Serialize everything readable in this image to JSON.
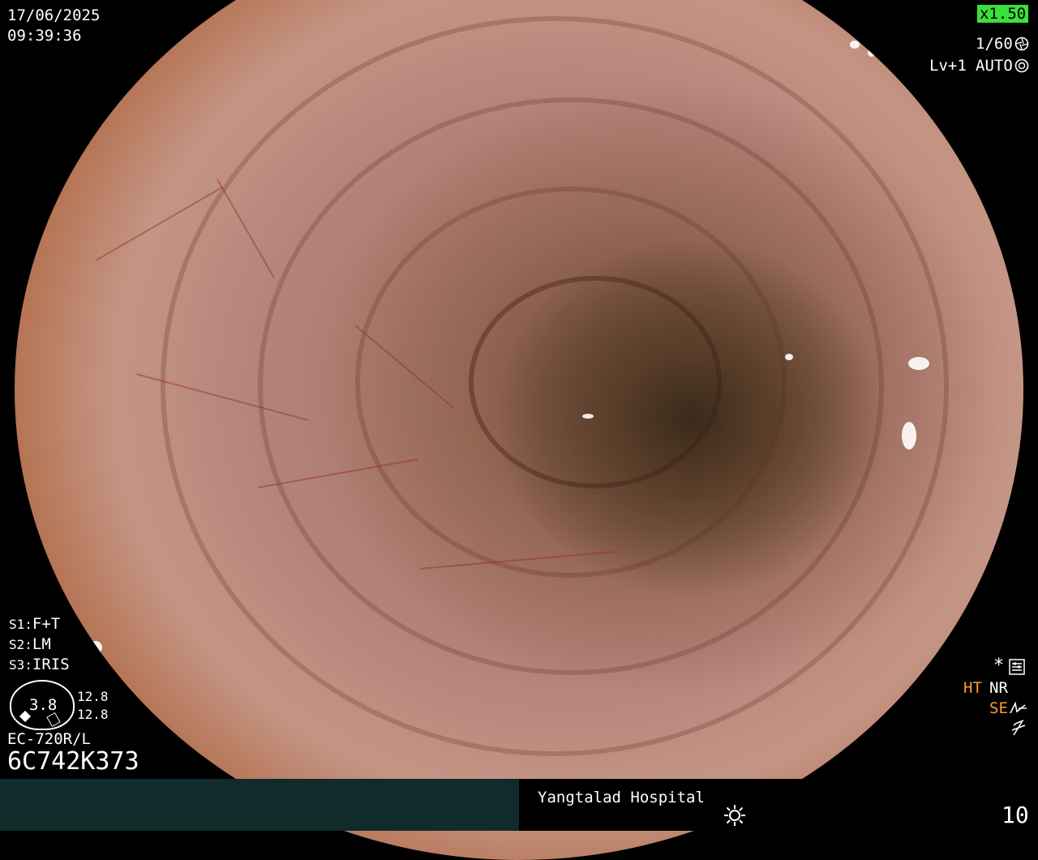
{
  "overlay": {
    "date": "17/06/2025",
    "time": "09:39:36",
    "zoom": "x1.50",
    "shutter": "1/60",
    "level": "Lv+1",
    "iris_mode": "AUTO",
    "s1": "F+T",
    "s2": "LM",
    "s3": "IRIS",
    "s1_label": "S1:",
    "s2_label": "S2:",
    "s3_label": "S3:",
    "gauge_value": "3.8",
    "gauge_top": "12.8",
    "gauge_bottom": "12.8",
    "scope_model": "EC-720R/L",
    "serial": "6C742K373",
    "asterisk": "*",
    "ht": "HT",
    "nr": "NR",
    "se": "SE"
  },
  "footer": {
    "hospital": "Yangtalad Hospital",
    "counter": "10"
  },
  "icons": {
    "shutter_icon": "aperture-icon",
    "iris_icon": "iris-icon",
    "settings_icon": "settings-icon",
    "se_icon": "structure-enhance-icon",
    "flash_icon": "lightning-icon",
    "light_icon": "sun-icon"
  },
  "colors": {
    "zoom_bg": "#3be03b",
    "orange": "#ff9a2e",
    "footer_bg": "#112a2a"
  }
}
